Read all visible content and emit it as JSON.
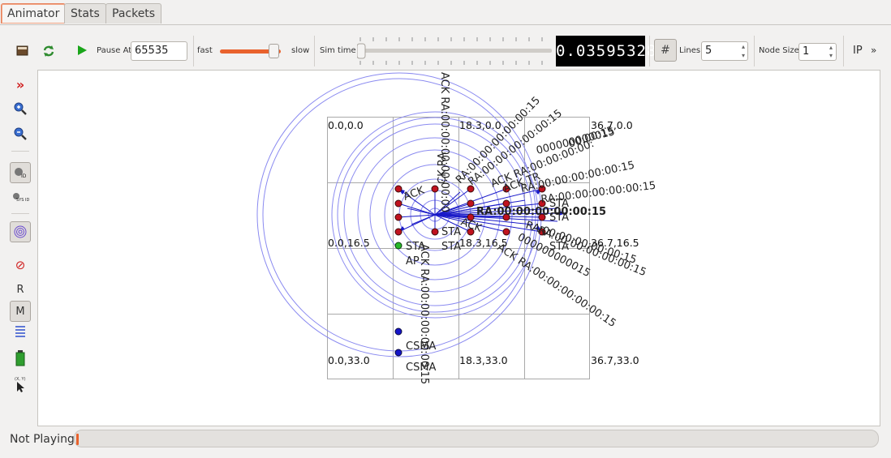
{
  "tabs": [
    {
      "label": "Animator",
      "active": true
    },
    {
      "label": "Stats",
      "active": false
    },
    {
      "label": "Packets",
      "active": false
    }
  ],
  "toolbar": {
    "open_icon": "folder-icon",
    "reload_icon": "refresh-icon",
    "play_icon": "play-icon",
    "pause_at_label": "Pause At",
    "pause_at_value": "65535",
    "fast_label": "fast",
    "slow_label": "slow",
    "speed_level": 0.9,
    "sim_time_label": "Sim time",
    "sim_time_value": "0.03595328",
    "sim_time_progress": 0.0,
    "grid_icon": "grid-icon",
    "lines_label": "Lines",
    "lines_value": "5",
    "node_size_label": "Node Size",
    "node_size_value": "1",
    "ip_label": "IP",
    "more_icon": "double-chevron-right-icon"
  },
  "sidebar": {
    "items": [
      {
        "name": "collapse-icon",
        "glyph": "»"
      },
      {
        "name": "zoom-in-icon",
        "glyph": "+"
      },
      {
        "name": "zoom-out-icon",
        "glyph": "−"
      },
      {
        "name": "node-id-icon",
        "glyph": "ID"
      },
      {
        "name": "sys-id-icon",
        "glyph": "SYS ID"
      },
      {
        "name": "wireless-circles-icon",
        "glyph": "◎"
      },
      {
        "name": "no-packets-icon",
        "glyph": "⊘"
      },
      {
        "name": "routing-label",
        "glyph": "R"
      },
      {
        "name": "mac-label",
        "glyph": "M"
      },
      {
        "name": "lines-icon",
        "glyph": "≡"
      },
      {
        "name": "battery-icon",
        "glyph": "▮"
      },
      {
        "name": "cursor-xy-icon",
        "glyph": "(X, Y)"
      }
    ]
  },
  "canvas": {
    "grid_labels": {
      "tl": "0.0,0.0",
      "tm": "18.3,0.0",
      "tr": "36.7,0.0",
      "ml": "0.0,16.5",
      "mm": "18.3,16.5",
      "mr": "36.7,16.5",
      "bl": "0.0,33.0",
      "bm": "18.3,33.0",
      "br": "36.7,33.0"
    },
    "node_labels": {
      "sta": "STA",
      "ap": "AP",
      "csma": "CSMA"
    },
    "packet_labels": {
      "ack_ra_15": "ACK RA:00:00:00:00:00:15",
      "ack_ra_trunc": "ACK RA:00:00:00:00:",
      "ra_15": "RA:00:00:00:00:00:15",
      "ra_15_short": "00:00:15",
      "ra_15_digits": "000000000015",
      "ack_ra_00": "ACK RA:00:00:00:00:00:00",
      "ack_ra_short": "CK RA",
      "ack_word": "ACK",
      "ack_tr": "ACK TR",
      "ack_trunc": "ACK RA:00:00:00:00:00:15"
    },
    "colors": {
      "sta_node": "#c0121e",
      "ap_node": "#28b828",
      "csma_node": "#1414c8",
      "range_circle": "#8a8af0",
      "packet_line": "#1a1ac8",
      "grid": "#a9a9a9"
    }
  },
  "status": {
    "text": "Not Playing",
    "progress": 0.0
  }
}
